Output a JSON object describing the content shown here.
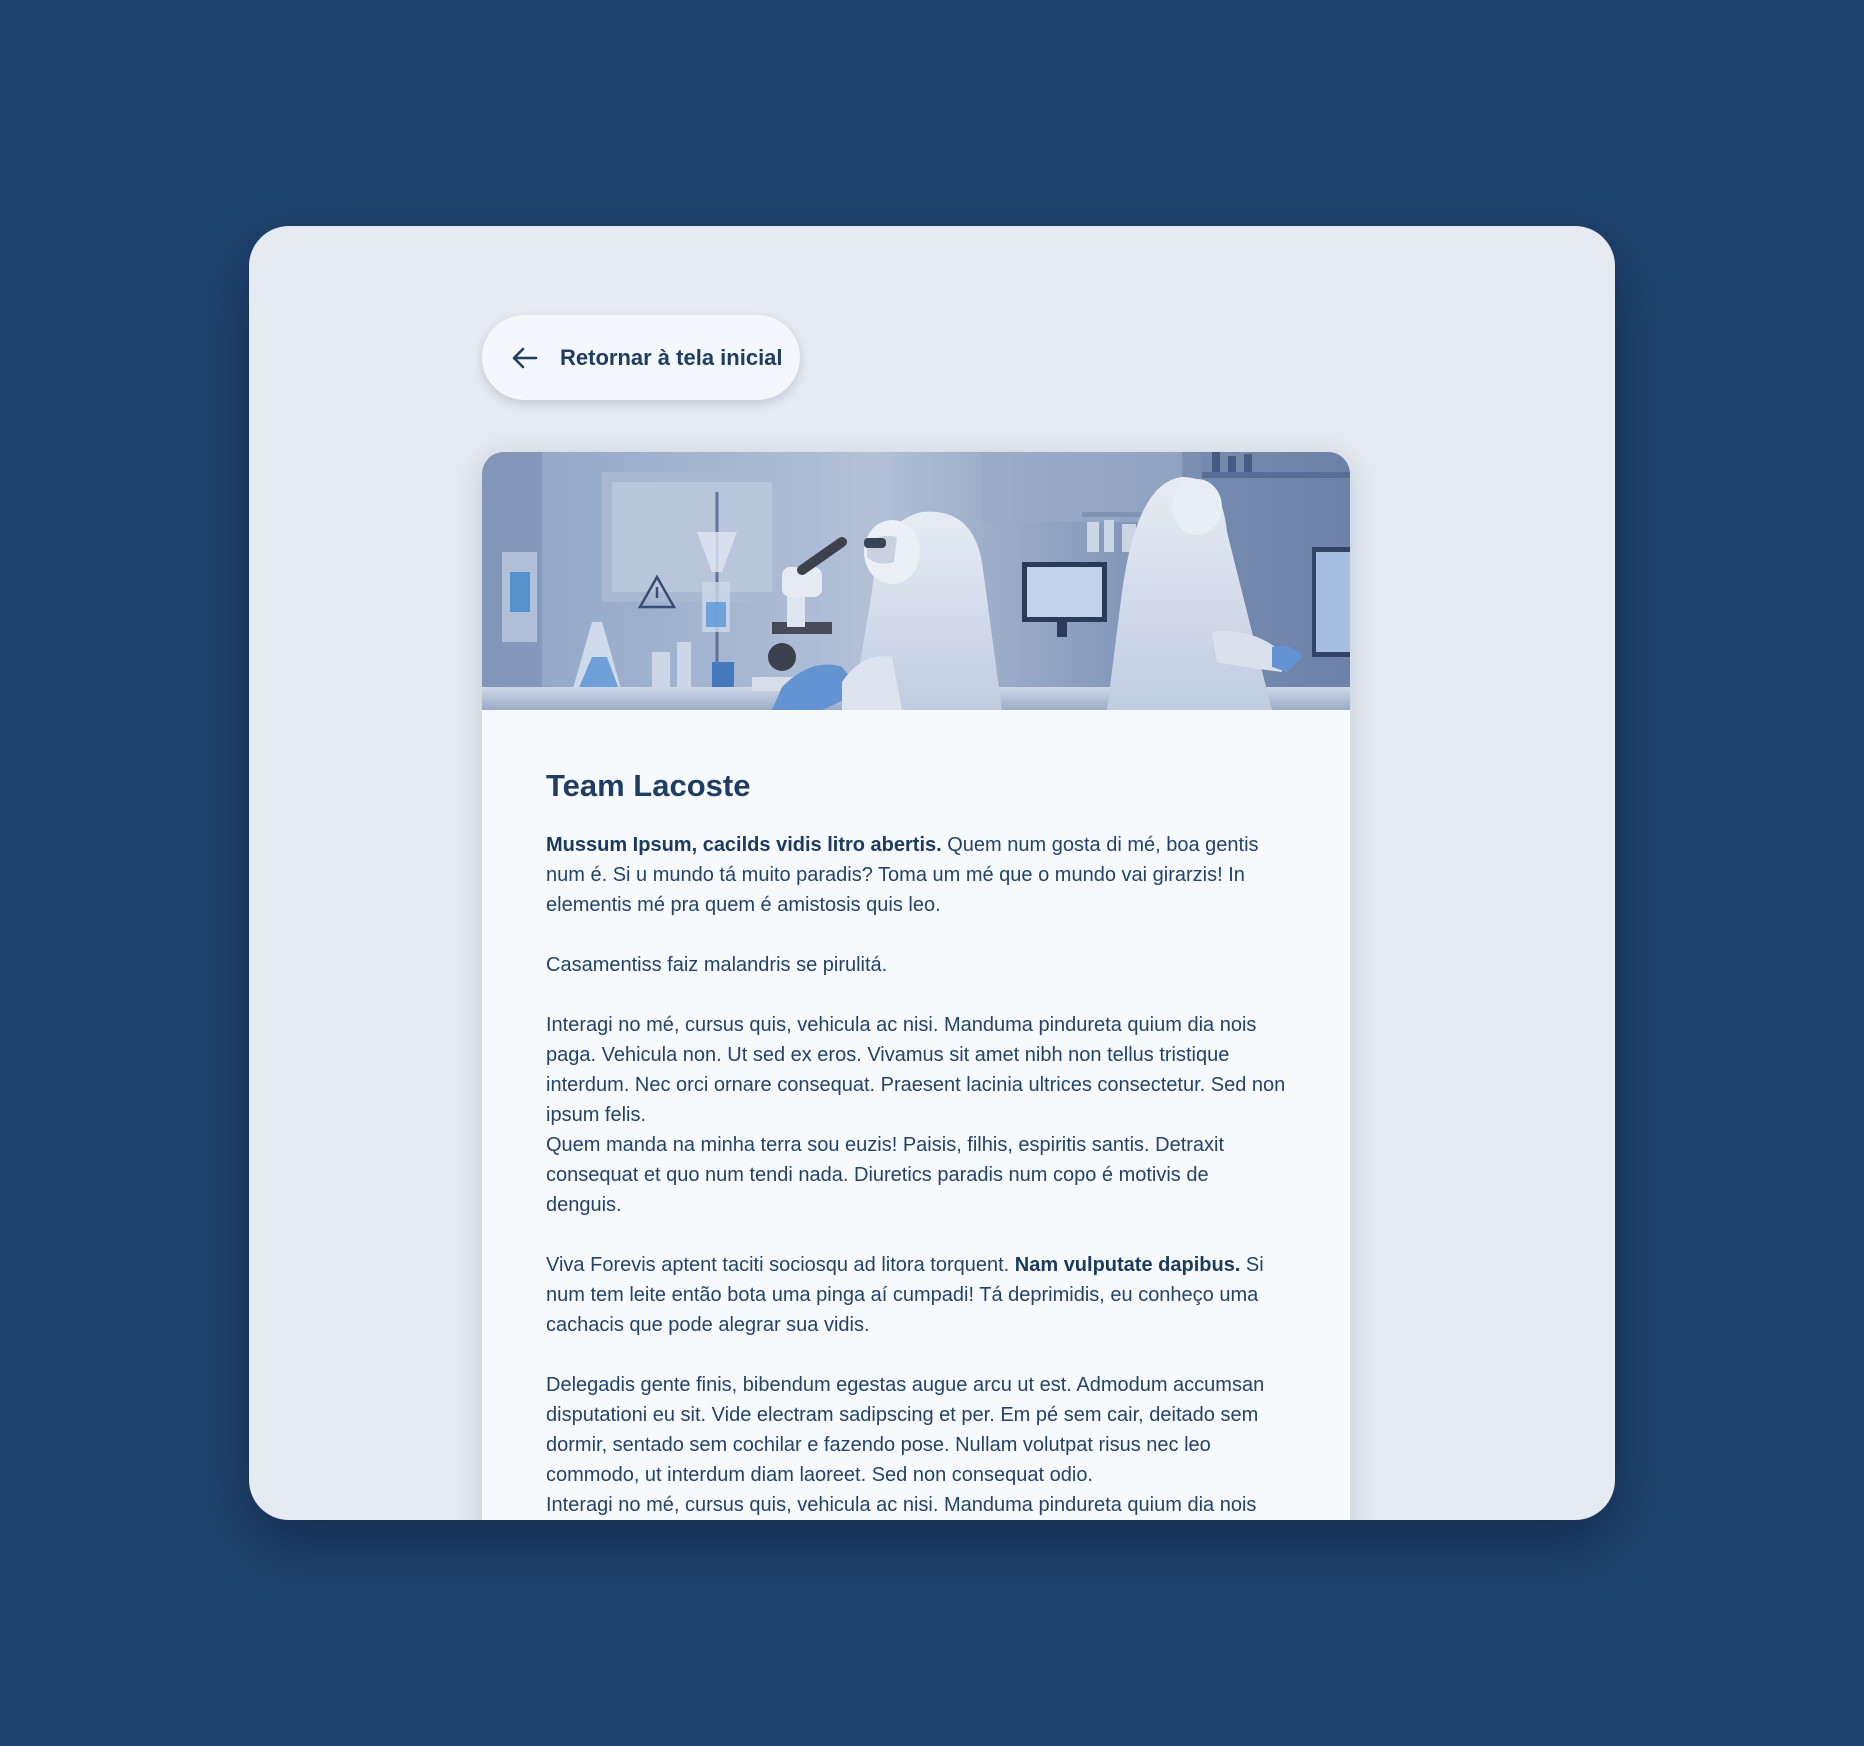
{
  "back_button": {
    "label": "Retornar à tela inicial",
    "icon": "arrow-left-icon"
  },
  "hero_image": {
    "description_icon": "laboratory-photo"
  },
  "article": {
    "title": "Team Lacoste",
    "p1_bold": "Mussum Ipsum, cacilds vidis litro abertis.",
    "p1_text": " Quem num gosta di mé, boa gentis num é. Si u mundo tá muito paradis? Toma um mé que o mundo vai girarzis! In elementis mé pra quem é amistosis quis leo.",
    "p2_text": "Casamentiss faiz malandris se pirulitá.",
    "p3_text_a": "Interagi no mé, cursus quis, vehicula ac nisi. Manduma pindureta quium dia nois paga. Vehicula non. Ut sed ex eros. Vivamus sit amet nibh non tellus tristique interdum. Nec orci ornare consequat. Praesent lacinia ultrices consectetur. Sed non ipsum felis.",
    "p3_text_b": "Quem manda na minha terra sou euzis! Paisis, filhis, espiritis santis. Detraxit consequat et quo num tendi nada. Diuretics paradis num copo é motivis de denguis.",
    "p4_text_a": "Viva Forevis aptent taciti sociosqu ad litora torquent. ",
    "p4_bold": "Nam vulputate dapibus.",
    "p4_text_b": " Si num tem leite então bota uma pinga aí cumpadi! Tá deprimidis, eu conheço uma cachacis que pode alegrar sua vidis.",
    "p5_text_a": "Delegadis gente finis, bibendum egestas augue arcu ut est. Admodum accumsan disputationi eu sit. Vide electram sadipscing et per. Em pé sem cair, deitado sem dormir, sentado sem cochilar e fazendo pose. Nullam volutpat risus nec leo commodo, ut interdum diam laoreet. Sed non consequat odio.",
    "p5_text_b": "Interagi no mé, cursus quis, vehicula ac nisi. Manduma pindureta quium dia nois paga. Vehicula non. Ut sed ex eros. Vivamus sit amet nibh non tell"
  },
  "colors": {
    "background": "#1f436f",
    "panel": "#e6eaf1",
    "card": "#f7fafc",
    "text": "#1f3d63"
  }
}
